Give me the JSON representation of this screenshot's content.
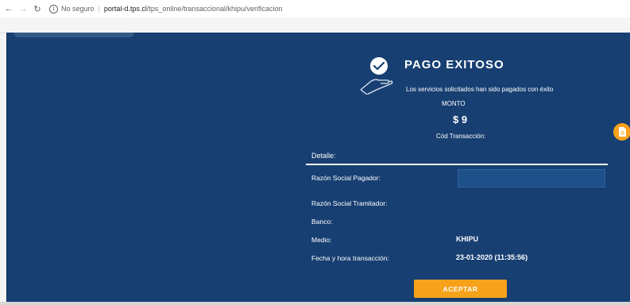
{
  "browser": {
    "security_label": "No seguro",
    "url_host": "portal-d.tps.cl",
    "url_path": "/tps_online/transaccional/khipu/verificacion"
  },
  "page": {
    "title": "PAGO EXITOSO",
    "subtitle": "Los servicios solicitados han sido pagados con éxito",
    "monto_label": "MONTO",
    "monto_value": "$ 9",
    "cod_label": "Cód Transacción:",
    "detalle_label": "Detalle:",
    "rows": [
      {
        "label": "Razón Social Pagador:",
        "value": ""
      },
      {
        "label": "Razón Social Tramitador:",
        "value": ""
      },
      {
        "label": "Banco:",
        "value": ""
      },
      {
        "label": "Medio:",
        "value": "KHIPU"
      },
      {
        "label": "Fecha y hora transacción:",
        "value": "23-01-2020 (11:35:56)"
      }
    ],
    "accept_label": "ACEPTAR"
  },
  "colors": {
    "background": "#173f72",
    "accent": "#f7a21b",
    "text": "#ffffff"
  }
}
